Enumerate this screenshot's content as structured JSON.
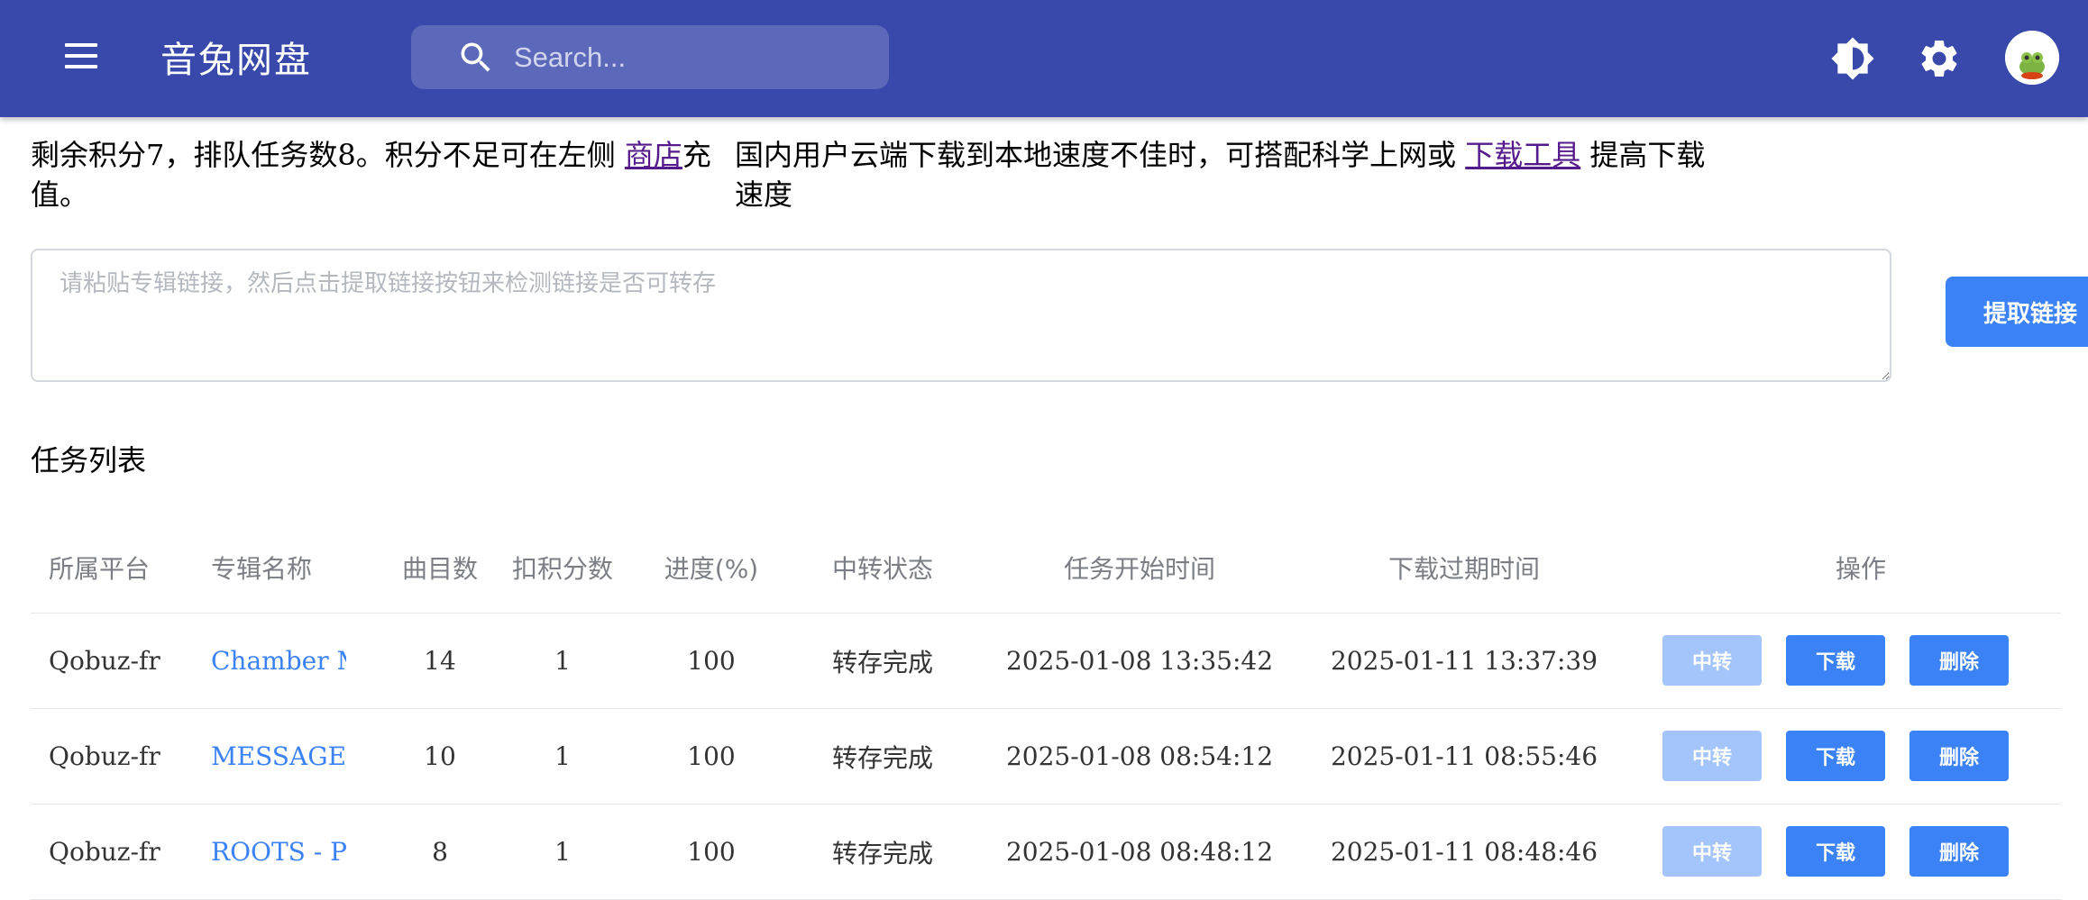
{
  "header": {
    "title": "音兔网盘",
    "search_placeholder": "Search...",
    "bg_color": "#3949ab"
  },
  "info": {
    "left_text_before": "剩余积分7，排队任务数8。积分不足可在左侧 ",
    "shop_link": "商店",
    "left_text_after": "充值。",
    "right_text_before": "国内用户云端下载到本地速度不佳时，可搭配科学上网或 ",
    "tool_link": "下载工具",
    "right_text_after": " 提高下载速度"
  },
  "extract": {
    "placeholder": "请粘贴专辑链接，然后点击提取链接按钮来检测链接是否可转存",
    "button_label": "提取链接"
  },
  "tasks": {
    "title": "任务列表",
    "columns": [
      "所属平台",
      "专辑名称",
      "曲目数",
      "扣积分数",
      "进度(%)",
      "中转状态",
      "任务开始时间",
      "下载过期时间",
      "操作"
    ],
    "rows": [
      {
        "platform": "Qobuz-fr",
        "album": "Chamber Mu",
        "tracks": "14",
        "credits": "1",
        "progress": "100",
        "status": "转存完成",
        "start": "2025-01-08 13:35:42",
        "expire": "2025-01-11 13:37:39",
        "relay": "中转",
        "download": "下载",
        "delete": "删除"
      },
      {
        "platform": "Qobuz-fr",
        "album": "MESSAGE -",
        "tracks": "10",
        "credits": "1",
        "progress": "100",
        "status": "转存完成",
        "start": "2025-01-08 08:54:12",
        "expire": "2025-01-11 08:55:46",
        "relay": "中转",
        "download": "下载",
        "delete": "删除"
      },
      {
        "platform": "Qobuz-fr",
        "album": "ROOTS - Pia",
        "tracks": "8",
        "credits": "1",
        "progress": "100",
        "status": "转存完成",
        "start": "2025-01-08 08:48:12",
        "expire": "2025-01-11 08:48:46",
        "relay": "中转",
        "download": "下载",
        "delete": "删除"
      }
    ]
  },
  "icons": [
    "menu-icon",
    "search-icon",
    "brightness-icon",
    "settings-icon",
    "avatar"
  ],
  "colors": {
    "primary": "#3b82f6",
    "disabled": "#a3c5fb",
    "credit": "#e02424"
  }
}
